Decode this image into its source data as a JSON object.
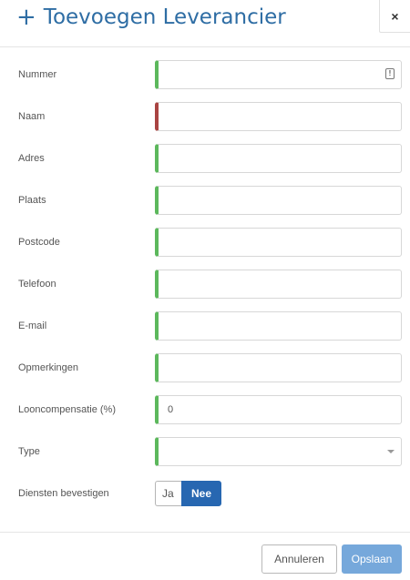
{
  "dialog": {
    "title": "Toevoegen Leverancier",
    "title_icon": "plus-icon",
    "close_symbol": "×",
    "accent_color": "#2e6da4"
  },
  "form": {
    "fields": [
      {
        "label": "Nummer",
        "value": "",
        "status": "valid",
        "icon": "id-badge-icon"
      },
      {
        "label": "Naam",
        "value": "",
        "status": "invalid"
      },
      {
        "label": "Adres",
        "value": "",
        "status": "valid"
      },
      {
        "label": "Plaats",
        "value": "",
        "status": "valid"
      },
      {
        "label": "Postcode",
        "value": "",
        "status": "valid"
      },
      {
        "label": "Telefoon",
        "value": "",
        "status": "valid"
      },
      {
        "label": "E-mail",
        "value": "",
        "status": "valid"
      },
      {
        "label": "Opmerkingen",
        "value": "",
        "status": "valid"
      },
      {
        "label": "Looncompensatie (%)",
        "value": "0",
        "status": "valid"
      },
      {
        "label": "Type",
        "value": "",
        "status": "valid",
        "control": "select",
        "icon": "chevron-down-icon"
      }
    ],
    "confirm_services": {
      "label": "Diensten bevestigen",
      "options": [
        "Ja",
        "Nee"
      ],
      "selected": "Nee"
    },
    "status_colors": {
      "valid": "#5cb85c",
      "invalid": "#a94442"
    }
  },
  "footer": {
    "cancel_label": "Annuleren",
    "save_label": "Opslaan"
  }
}
